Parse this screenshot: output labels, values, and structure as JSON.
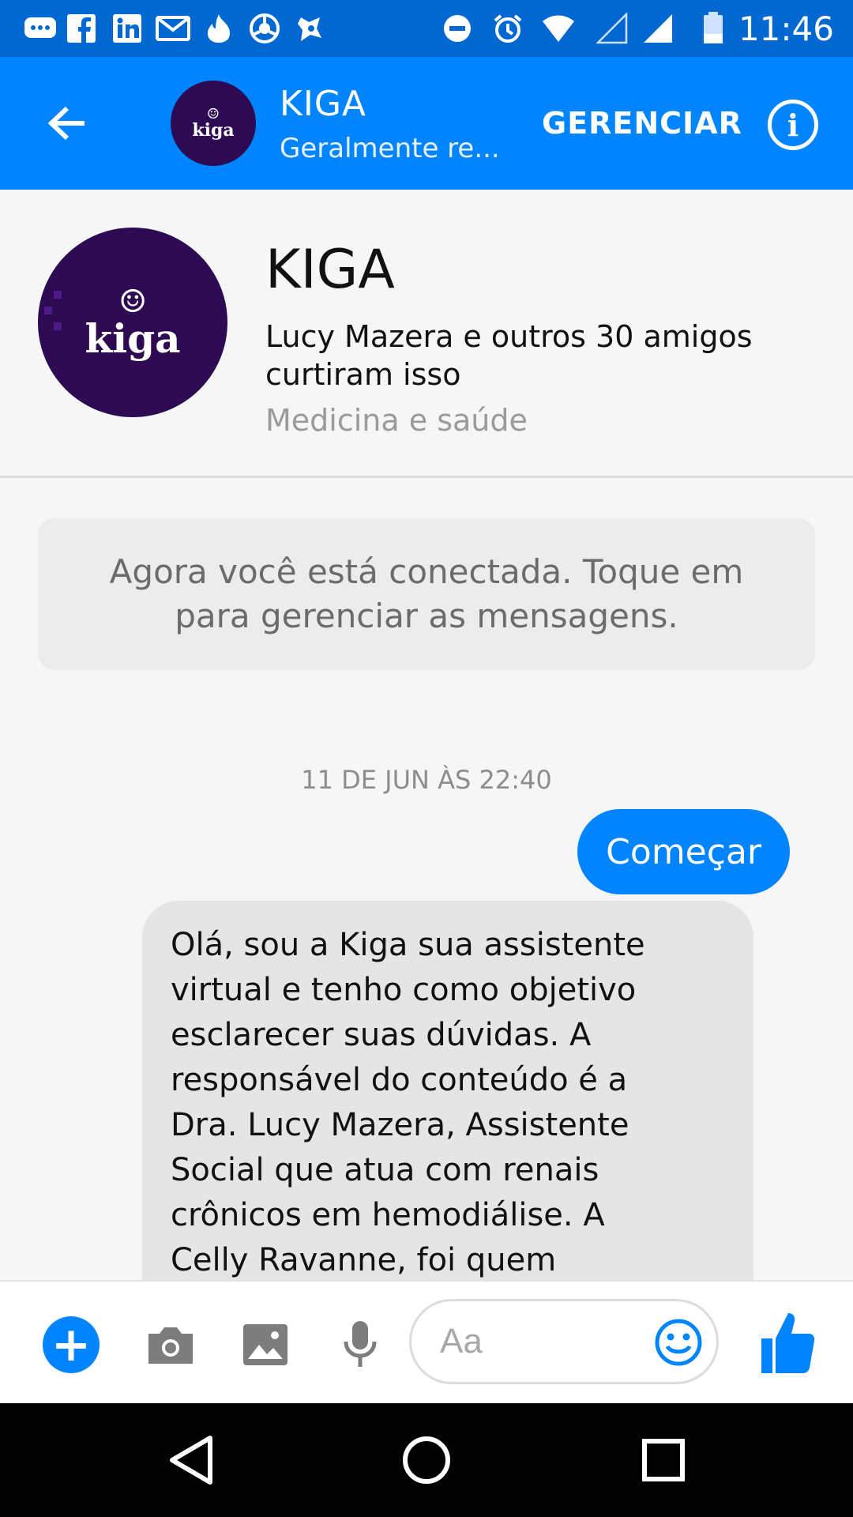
{
  "status_bar": {
    "time": "11:46",
    "icons": [
      "messenger-icon",
      "facebook-icon",
      "linkedin-icon",
      "gmail-icon",
      "tinder-icon",
      "chrome-icon",
      "app-icon",
      "do-not-disturb-icon",
      "alarm-icon",
      "wifi-icon",
      "signal-empty-icon",
      "signal-icon",
      "battery-icon"
    ]
  },
  "header": {
    "title": "KIGA",
    "subtitle": "Geralmente re...",
    "manage_label": "GERENCIAR",
    "avatar_text": "kiga",
    "info_glyph": "i"
  },
  "profile": {
    "name": "KIGA",
    "likes": "Lucy Mazera e outros 30 amigos curtiram isso",
    "category": "Medicina e saúde",
    "avatar_text": "kiga"
  },
  "notice": {
    "text": "Agora você está conectada. Toque em para gerenciar as mensagens."
  },
  "conversation": {
    "timestamp": "11 DE JUN ÀS 22:40",
    "outgoing_message": "Começar",
    "incoming_message": "Olá, sou a Kiga sua assistente\nvirtual e tenho como objetivo\nesclarecer  suas dúvidas.  A\nresponsável do conteúdo é a\nDra. Lucy Mazera, Assistente\nSocial que atua com renais\ncrônicos em hemodiálise. A\nCelly Ravanne,  foi quem"
  },
  "composer": {
    "placeholder": "Aa",
    "plus_glyph": "+"
  },
  "colors": {
    "accent": "#0084ff",
    "status_bar": "#0068d0",
    "avatar_bg": "#2d0a52",
    "incoming_bubble": "#e5e5e5"
  }
}
